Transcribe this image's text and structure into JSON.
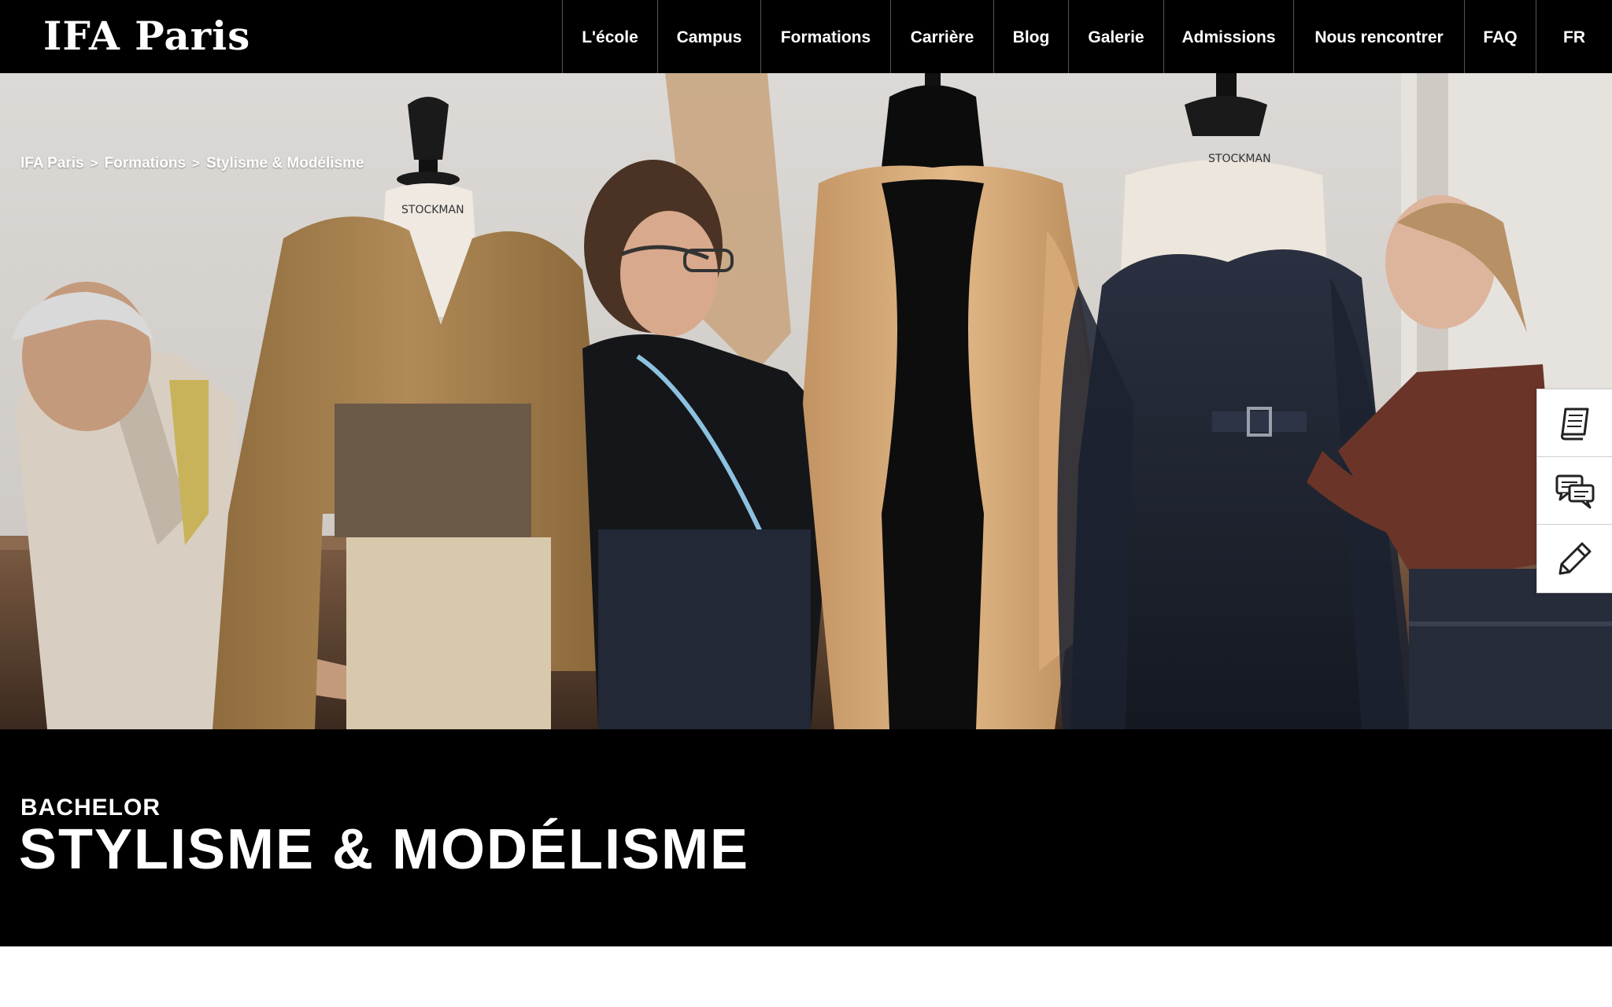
{
  "brand": {
    "logo_text": "IFA Paris"
  },
  "nav": {
    "items": [
      {
        "label": "L'école"
      },
      {
        "label": "Campus"
      },
      {
        "label": "Formations"
      },
      {
        "label": "Carrière"
      },
      {
        "label": "Blog"
      },
      {
        "label": "Galerie"
      },
      {
        "label": "Admissions"
      },
      {
        "label": "Nous rencontrer"
      },
      {
        "label": "FAQ"
      },
      {
        "label": "FR"
      }
    ]
  },
  "breadcrumb": {
    "items": [
      "IFA Paris",
      "Formations",
      "Stylisme & Modélisme"
    ],
    "separator": ">"
  },
  "hero": {
    "mannequin_tag_1": "STOCKMAN",
    "mannequin_tag_2": "STOCKMAN"
  },
  "side_actions": [
    {
      "icon": "brochure-book-icon"
    },
    {
      "icon": "chat-bubbles-icon"
    },
    {
      "icon": "pencil-icon"
    }
  ],
  "program": {
    "level": "BACHELOR",
    "title": "STYLISME & MODÉLISME"
  },
  "colors": {
    "header_bg": "#000000",
    "text_light": "#ffffff",
    "band_bg": "#000000"
  }
}
